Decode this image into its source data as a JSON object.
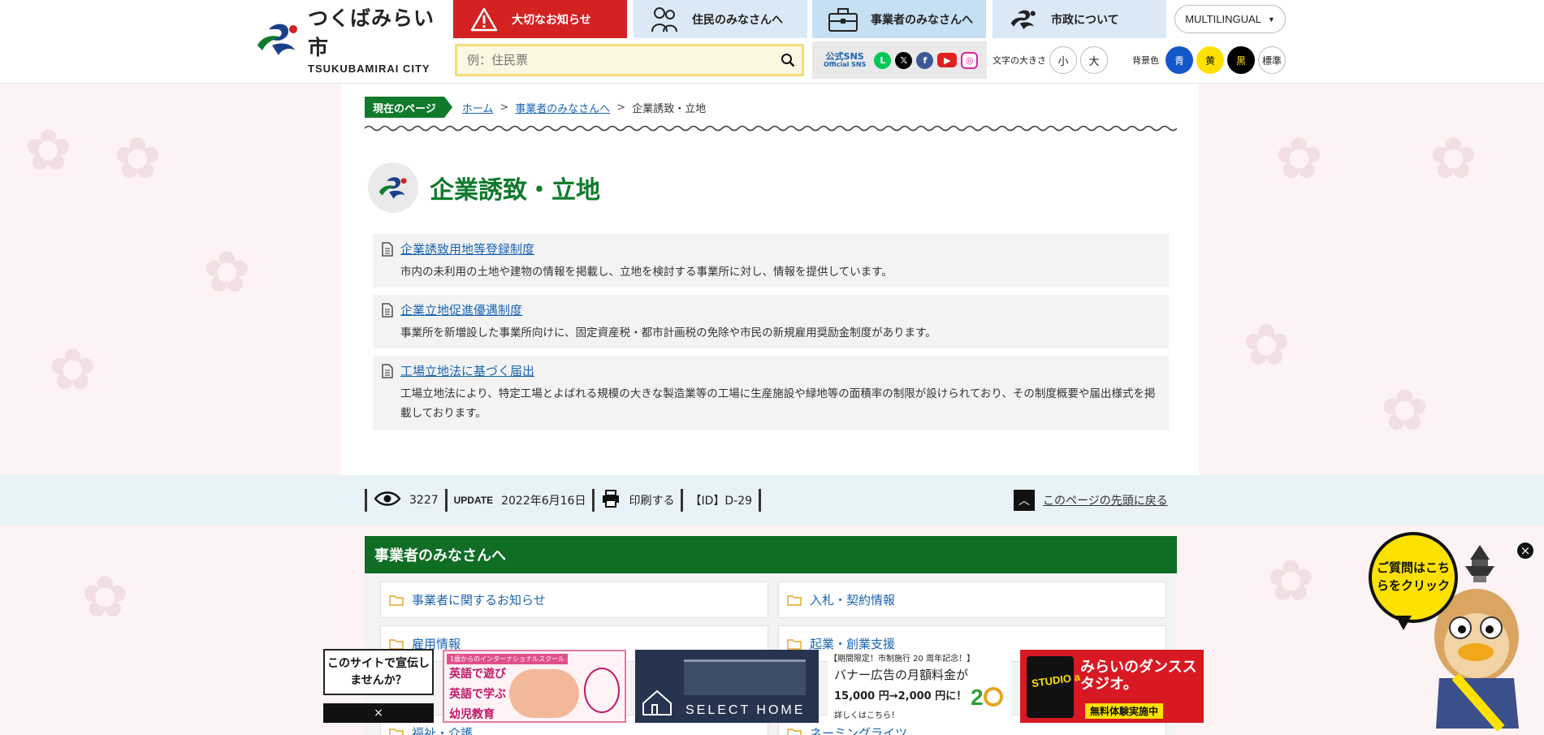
{
  "header": {
    "logo_jp": "つくばみらい市",
    "logo_en": "TSUKUBAMIRAI CITY",
    "nav": [
      {
        "label": "大切なお知らせ"
      },
      {
        "label": "住民のみなさんへ"
      },
      {
        "label": "事業者のみなさんへ"
      },
      {
        "label": "市政について"
      }
    ],
    "multilingual": "MULTILINGUAL",
    "search_placeholder": "例：住民票",
    "sns_label_1": "公式SNS",
    "sns_label_2": "Official SNS",
    "sns_icons": [
      "line-icon",
      "x-icon",
      "facebook-icon",
      "youtube-icon",
      "instagram-icon"
    ],
    "fontsize_label": "文字の大きさ",
    "fontsize_small": "小",
    "fontsize_large": "大",
    "bg_label": "背景色",
    "bg_options": [
      {
        "label": "青",
        "color": "#1457c9"
      },
      {
        "label": "黄",
        "color": "#ffe000"
      },
      {
        "label": "黒",
        "color": "#000000"
      },
      {
        "label": "標準",
        "color": "#ffffff"
      }
    ]
  },
  "breadcrumb": {
    "current_label": "現在のページ",
    "items": [
      "ホーム",
      "事業者のみなさんへ"
    ],
    "separator": ">",
    "current": "企業誘致・立地"
  },
  "page": {
    "title": "企業誘致・立地",
    "items": [
      {
        "title": "企業誘致用地等登録制度",
        "desc": "市内の未利用の土地や建物の情報を掲載し、立地を検討する事業所に対し、情報を提供しています。"
      },
      {
        "title": "企業立地促進優遇制度",
        "desc": "事業所を新増設した事業所向けに、固定資産税・都市計画税の免除や市民の新規雇用奨励金制度があります。"
      },
      {
        "title": "工場立地法に基づく届出",
        "desc": "工場立地法により、特定工場とよばれる規模の大きな製造業等の工場に生産施設や緑地等の面積率の制限が設けられており、その制度概要や届出様式を掲載しております。"
      }
    ]
  },
  "info": {
    "views": "3227",
    "update_label": "UPDATE",
    "update_date": "2022年6月16日",
    "print": "印刷する",
    "id": "【ID】D-29",
    "to_top": "このページの先頭に戻る"
  },
  "section": {
    "title": "事業者のみなさんへ",
    "categories": [
      "事業者に関するお知らせ",
      "入札・契約情報",
      "雇用情報",
      "起業・創業支援",
      "福祉・介護",
      "ネーミングライツ"
    ]
  },
  "ads": {
    "promo": "このサイトで宣伝しませんか？",
    "close": "×",
    "ad1_line1": "英語で遊び",
    "ad1_line2": "英語で学ぶ",
    "ad1_line3": "幼児教育",
    "ad1_tag": "1歳からのインターナショナルスクール",
    "ad2": "SELECT HOME",
    "ad3_top": "【期間限定！市制施行 20 周年記念！】",
    "ad3_main": "バナー広告の月額料金が",
    "ad3_price": "15,000 円→2,000 円に！",
    "ad3_more": "詳しくはこちら！",
    "ad4_brand": "STUDIO a",
    "ad4_main": "みらいのダンススタジオ。",
    "ad4_sub": "無料体験実施中"
  },
  "chat": {
    "bubble": "ご質問はこちらをクリック",
    "close": "×"
  }
}
